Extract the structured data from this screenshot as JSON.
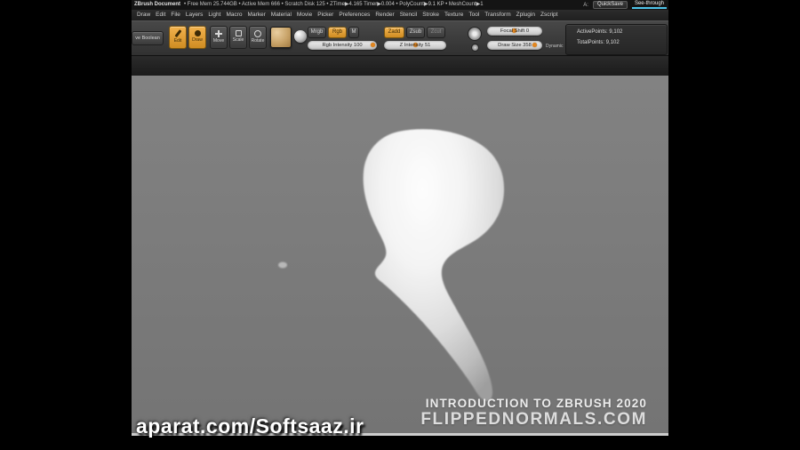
{
  "title_bar": {
    "title": "ZBrush Document",
    "stats": "• Free Mem 25.744GB • Active Mem 666 • Scratch Disk 125 •  ZTime▶4.165 Timer▶0.004 • PolyCount▶9.1 KP • MeshCount▶1",
    "autosave_label": "A:",
    "quicksave_label": "QuickSave",
    "see_through_label": "See-through"
  },
  "menu": {
    "items": [
      "Draw",
      "Edit",
      "File",
      "Layers",
      "Light",
      "Macro",
      "Marker",
      "Material",
      "Movie",
      "Picker",
      "Preferences",
      "Render",
      "Stencil",
      "Stroke",
      "Texture",
      "Tool",
      "Transform",
      "Zplugin",
      "Zscript"
    ]
  },
  "shelf": {
    "live_boolean_label": "ve Boolean",
    "edit_label": "Edit",
    "draw_label": "Draw",
    "move_label": "Move",
    "scale_label": "Scale",
    "rotate_label": "Rotate",
    "mrgb_label": "Mrgb",
    "rgb_label": "Rgb",
    "m_label": "M",
    "rgb_intensity_label": "Rgb Intensity 100",
    "zadd_label": "Zadd",
    "zsub_label": "Zsub",
    "zcut_label": "Zcut",
    "z_intensity_label": "Z Intensity 51",
    "focal_shift_label": "Focal Shift 0",
    "draw_size_label": "Draw Size 358",
    "dynamic_label": "Dynamic",
    "active_points": "ActivePoints: 9,102",
    "total_points": "TotalPoints: 9,102"
  },
  "canvas": {
    "watermark_title": "INTRODUCTION TO ZBRUSH 2020",
    "watermark_site": "FLIPPEDNORMALS.COM",
    "video_watermark": "aparat.com/Softsaaz.ir"
  },
  "colors": {
    "accent_orange": "#e2861f",
    "canvas_gray": "#7b7b7b",
    "see_through_blue": "#4fc3e8"
  }
}
